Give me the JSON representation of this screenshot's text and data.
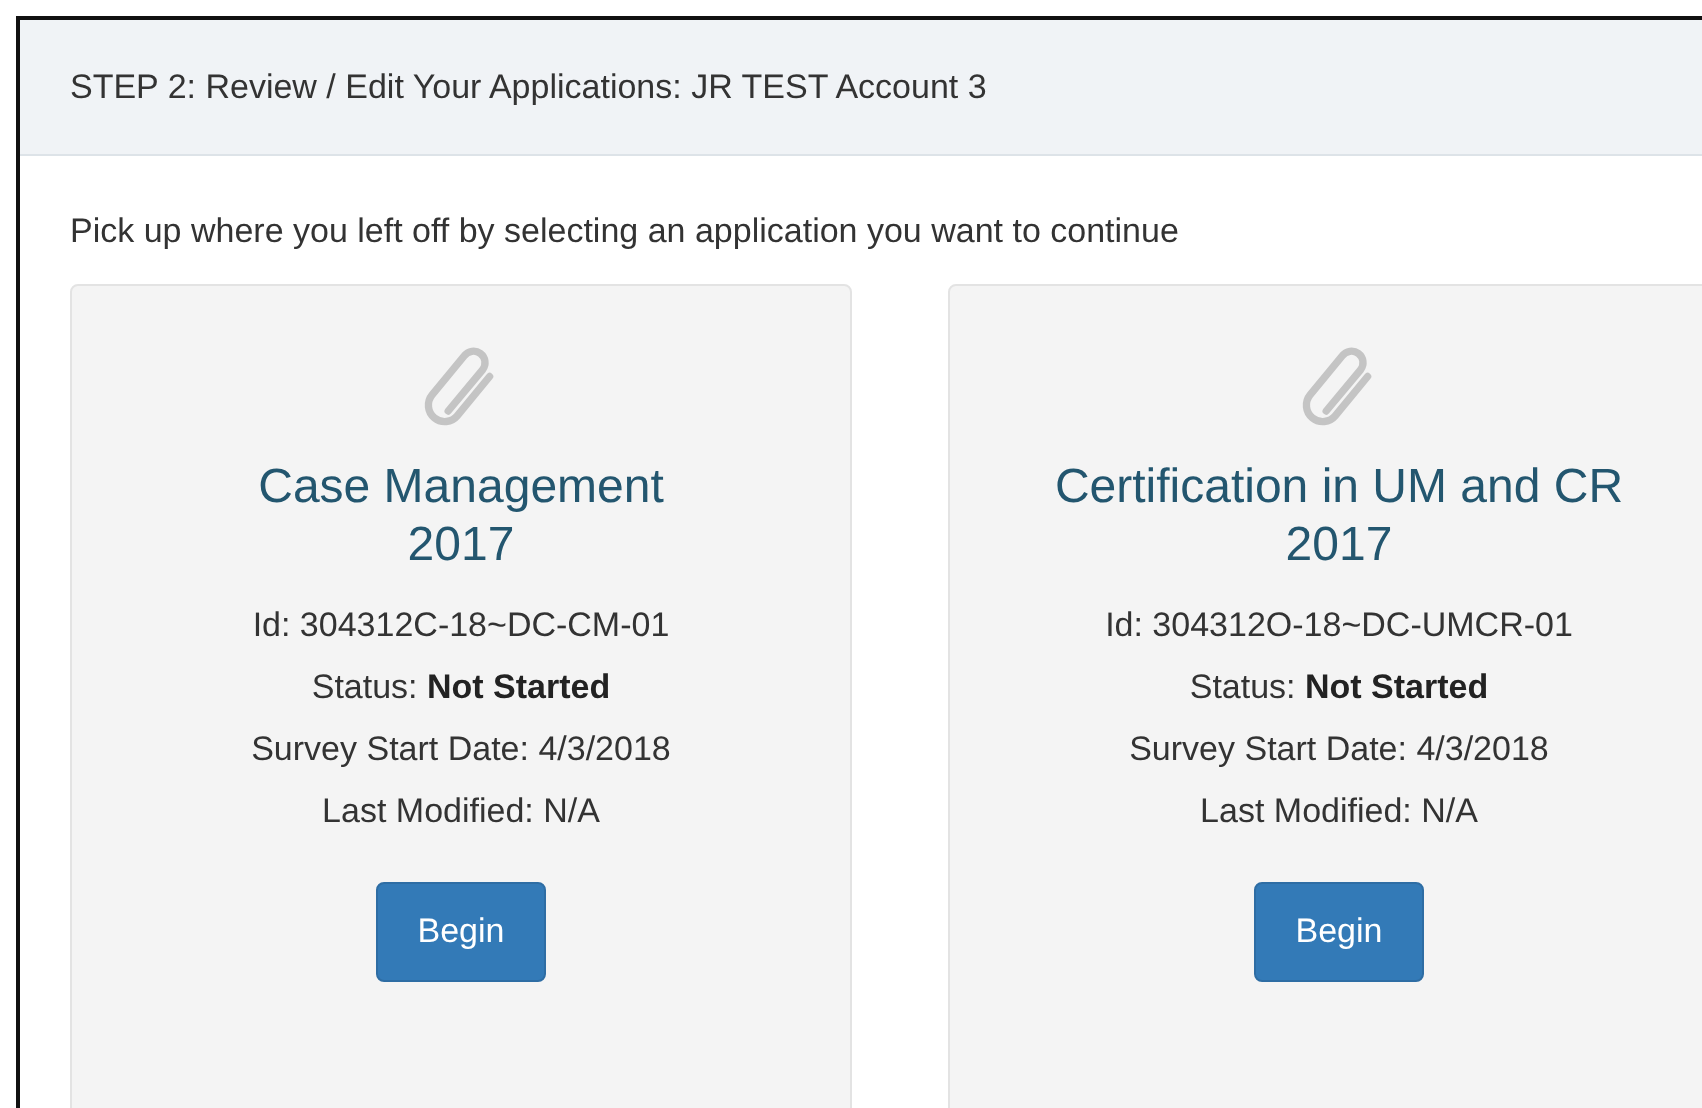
{
  "panel": {
    "heading": "STEP 2: Review / Edit Your Applications: JR TEST Account 3",
    "intro": "Pick up where you left off by selecting an application you want to continue"
  },
  "applications": [
    {
      "title_lines": [
        "Case Management",
        "2017"
      ],
      "id_line": "Id: 304312C-18~DC-CM-01",
      "status_line": "Status: **Not Started**",
      "date_line": "Survey Start Date: 4/3/2018",
      "modified_line": "Last Modified: N/A",
      "button": "Begin"
    },
    {
      "title_lines": [
        "Certification in UM and CR",
        "2017"
      ],
      "id_line": "Id: 304312O-18~DC-UMCR-01",
      "status_line": "Status: **Not Started**",
      "date_line": "Survey Start Date: 4/3/2018",
      "modified_line": "Last Modified: N/A",
      "button": "Begin"
    }
  ]
}
